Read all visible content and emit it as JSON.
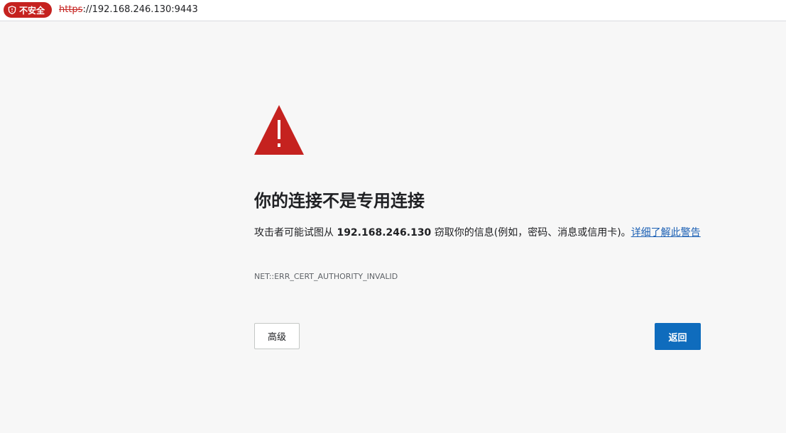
{
  "address_bar": {
    "security_label": "不安全",
    "url_scheme": "https",
    "url_rest": "://192.168.246.130:9443"
  },
  "interstitial": {
    "heading": "你的连接不是专用连接",
    "message_prefix": "攻击者可能试图从 ",
    "host": "192.168.246.130",
    "message_suffix": " 窃取你的信息(例如，密码、消息或信用卡)。",
    "learn_more_link": "详细了解此警告",
    "error_code": "NET::ERR_CERT_AUTHORITY_INVALID",
    "advanced_button": "高级",
    "back_button": "返回"
  },
  "colors": {
    "insecure_red": "#c5221f",
    "warning_icon": "#c5221f",
    "primary_button": "#0f6cbd",
    "link": "#1a5fb4"
  },
  "icons": {
    "security": "shield-icon",
    "warning": "warning-triangle-icon"
  }
}
